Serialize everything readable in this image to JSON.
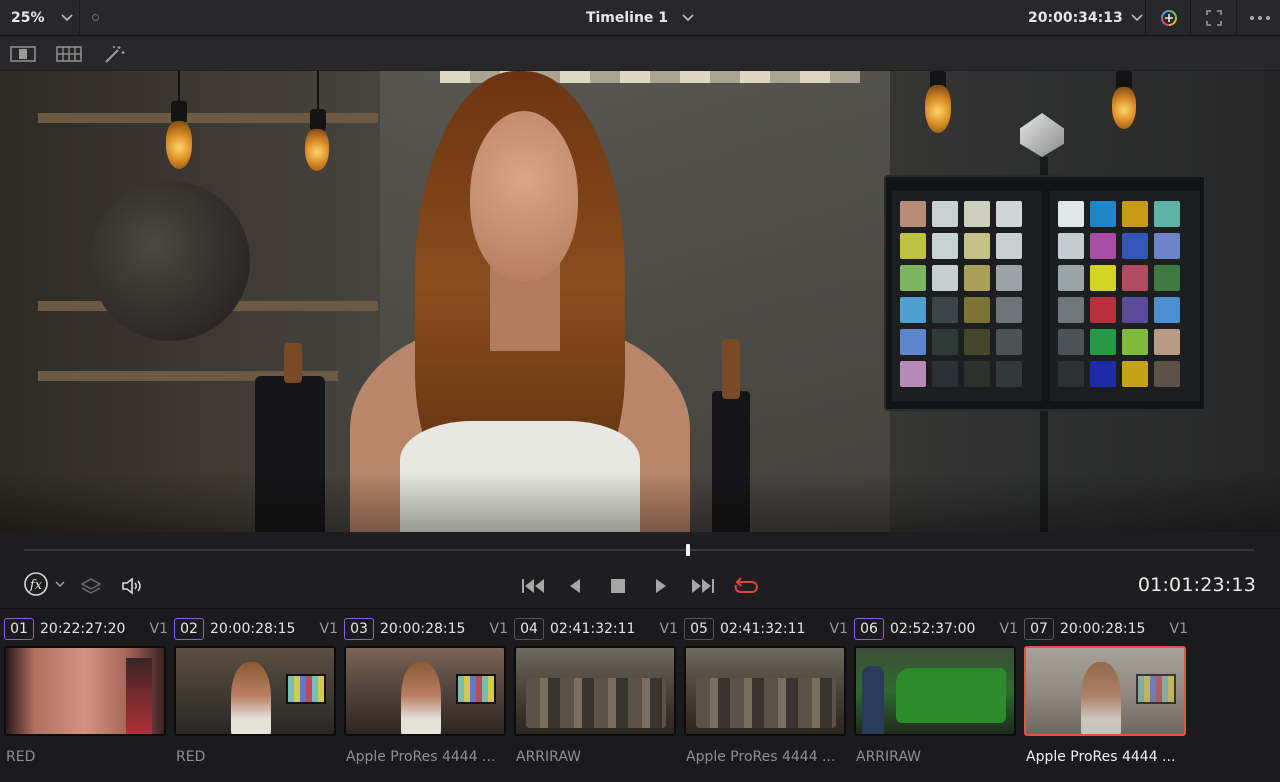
{
  "topbar": {
    "zoom": "25%",
    "timeline_title": "Timeline 1",
    "timecode": "20:00:34:13"
  },
  "icons": {
    "zoom_dropdown": "chevron-down-icon",
    "title_dropdown": "chevron-down-icon",
    "timecode_dropdown": "chevron-down-icon",
    "color_effects": "color-wheel-icon",
    "fullscreen": "expand-icon",
    "more": "more-icon",
    "single_viewer": "single-viewer-icon",
    "grid_viewer": "grid-viewer-icon",
    "magic_wand": "magic-wand-icon",
    "fx": "fx-icon",
    "layers": "layers-icon",
    "audio": "speaker-icon",
    "go_to_start": "skip-back-icon",
    "step_back": "play-reverse-icon",
    "stop": "stop-icon",
    "play": "play-icon",
    "go_to_end": "skip-forward-icon",
    "loop": "loop-icon"
  },
  "playback": {
    "timecode": "01:01:23:13",
    "playhead_position": 0.54
  },
  "colors": {
    "accent_selection": "#e2553c",
    "loop_active": "#e0443a"
  },
  "clips": [
    {
      "number": "01",
      "timecode": "20:22:27:20",
      "track": "V1",
      "codec": "RED",
      "selected": false,
      "badge_color": "#8b5cf6"
    },
    {
      "number": "02",
      "timecode": "20:00:28:15",
      "track": "V1",
      "codec": "RED",
      "selected": false,
      "badge_color": "#8b5cf6"
    },
    {
      "number": "03",
      "timecode": "20:00:28:15",
      "track": "V1",
      "codec": "Apple ProRes 4444 ...",
      "selected": false,
      "badge_color": "#8b5cf6"
    },
    {
      "number": "04",
      "timecode": "02:41:32:11",
      "track": "V1",
      "codec": "ARRIRAW",
      "selected": false,
      "badge_color": "#555555"
    },
    {
      "number": "05",
      "timecode": "02:41:32:11",
      "track": "V1",
      "codec": "Apple ProRes 4444 ...",
      "selected": false,
      "badge_color": "#555555"
    },
    {
      "number": "06",
      "timecode": "02:52:37:00",
      "track": "V1",
      "codec": "ARRIRAW",
      "selected": false,
      "badge_color": "#8b5cf6"
    },
    {
      "number": "07",
      "timecode": "20:00:28:15",
      "track": "V1",
      "codec": "Apple ProRes 4444 ...",
      "selected": true,
      "badge_color": "#555555"
    }
  ]
}
